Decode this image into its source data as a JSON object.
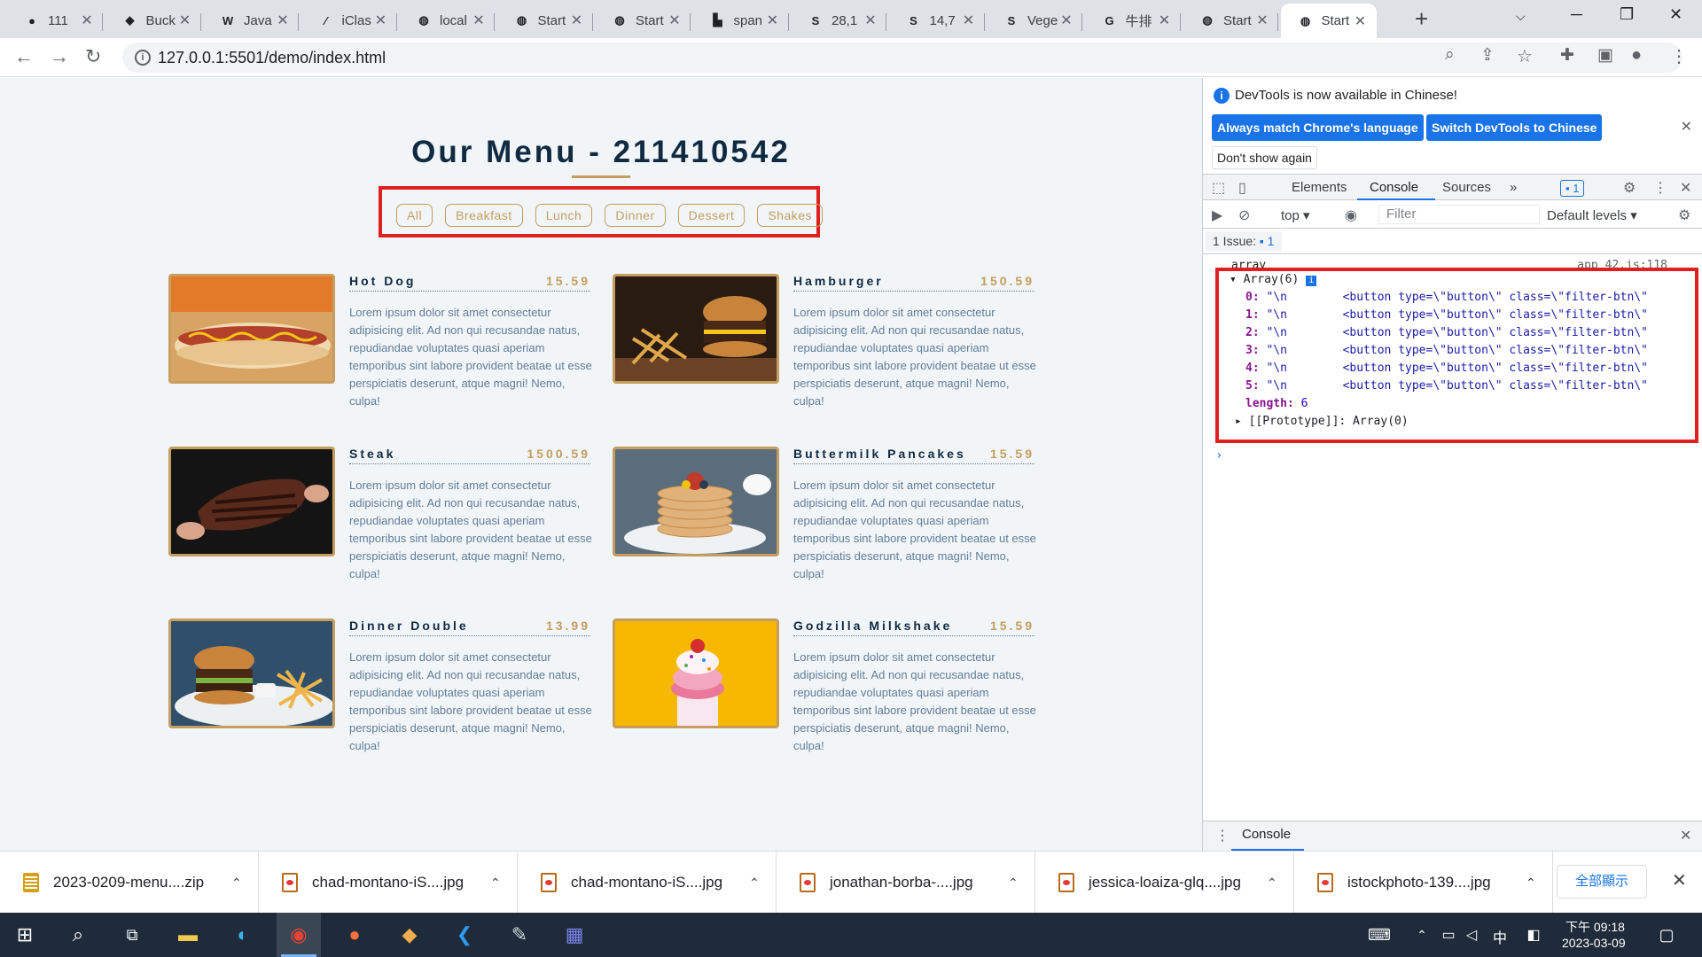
{
  "tabs": [
    {
      "title": "111",
      "icon": "github-icon",
      "icon_glyph": "●"
    },
    {
      "title": "Buck",
      "icon": "bucket-icon",
      "icon_glyph": "◆"
    },
    {
      "title": "Java",
      "icon": "w3schools-icon",
      "icon_glyph": "W"
    },
    {
      "title": "iClas",
      "icon": "iclass-icon",
      "icon_glyph": "∕"
    },
    {
      "title": "local",
      "icon": "globe-icon",
      "icon_glyph": "◍"
    },
    {
      "title": "Start",
      "icon": "globe-icon",
      "icon_glyph": "◍"
    },
    {
      "title": "Start",
      "icon": "globe-icon",
      "icon_glyph": "◍"
    },
    {
      "title": "span",
      "icon": "stackoverflow-icon",
      "icon_glyph": "▙"
    },
    {
      "title": "28,1",
      "icon": "s-icon",
      "icon_glyph": "S"
    },
    {
      "title": "14,7",
      "icon": "s-icon",
      "icon_glyph": "S"
    },
    {
      "title": "Vege",
      "icon": "s-icon",
      "icon_glyph": "S"
    },
    {
      "title": "牛排",
      "icon": "google-icon",
      "icon_glyph": "G"
    },
    {
      "title": "Start",
      "icon": "globe-icon",
      "icon_glyph": "◍"
    },
    {
      "title": "Start",
      "icon": "globe-icon",
      "icon_glyph": "◍",
      "active": true
    }
  ],
  "address": {
    "url": "127.0.0.1:5501/demo/index.html"
  },
  "page": {
    "title": "Our Menu - 211410542",
    "filters": [
      "All",
      "Breakfast",
      "Lunch",
      "Dinner",
      "Dessert",
      "Shakes"
    ],
    "items": [
      {
        "name": "Hot Dog",
        "price": "15.59",
        "desc": "Lorem ipsum dolor sit amet consectetur adipisicing elit. Ad non qui recusandae natus, repudiandae voluptates quasi aperiam temporibus sint labore provident beatae ut esse perspiciatis deserunt, atque magni! Nemo, culpa!",
        "photo": "hot-dog-photo"
      },
      {
        "name": "Hamburger",
        "price": "150.59",
        "desc": "Lorem ipsum dolor sit amet consectetur adipisicing elit. Ad non qui recusandae natus, repudiandae voluptates quasi aperiam temporibus sint labore provident beatae ut esse perspiciatis deserunt, atque magni! Nemo, culpa!",
        "photo": "hamburger-photo"
      },
      {
        "name": "Steak",
        "price": "1500.59",
        "desc": "Lorem ipsum dolor sit amet consectetur adipisicing elit. Ad non qui recusandae natus, repudiandae voluptates quasi aperiam temporibus sint labore provident beatae ut esse perspiciatis deserunt, atque magni! Nemo, culpa!",
        "photo": "steak-photo"
      },
      {
        "name": "Buttermilk Pancakes",
        "price": "15.59",
        "desc": "Lorem ipsum dolor sit amet consectetur adipisicing elit. Ad non qui recusandae natus, repudiandae voluptates quasi aperiam temporibus sint labore provident beatae ut esse perspiciatis deserunt, atque magni! Nemo, culpa!",
        "photo": "pancakes-photo"
      },
      {
        "name": "Dinner Double",
        "price": "13.99",
        "desc": "Lorem ipsum dolor sit amet consectetur adipisicing elit. Ad non qui recusandae natus, repudiandae voluptates quasi aperiam temporibus sint labore provident beatae ut esse perspiciatis deserunt, atque magni! Nemo, culpa!",
        "photo": "dinner-double-photo"
      },
      {
        "name": "Godzilla Milkshake",
        "price": "15.59",
        "desc": "Lorem ipsum dolor sit amet consectetur adipisicing elit. Ad non qui recusandae natus, repudiandae voluptates quasi aperiam temporibus sint labore provident beatae ut esse perspiciatis deserunt, atque magni! Nemo, culpa!",
        "photo": "milkshake-photo"
      }
    ]
  },
  "devtools": {
    "banner_text": "DevTools is now available in Chinese!",
    "btn_match": "Always match Chrome's language",
    "btn_switch": "Switch DevTools to Chinese",
    "btn_dont_show": "Don't show again",
    "tabs": [
      "Elements",
      "Console",
      "Sources"
    ],
    "active_tab": "Console",
    "issues_badge": "1",
    "context": "top",
    "filter_placeholder": "Filter",
    "levels": "Default levels",
    "issues_label": "1 Issue:",
    "issues_count": "1",
    "log_label": "array",
    "log_source": "app_42.js:118",
    "array_head": "Array(6)",
    "array_entries": [
      {
        "key": "0:",
        "value": "\"\\n        <button type=\\\"button\\\" class=\\\"filter-btn\\\""
      },
      {
        "key": "1:",
        "value": "\"\\n        <button type=\\\"button\\\" class=\\\"filter-btn\\\""
      },
      {
        "key": "2:",
        "value": "\"\\n        <button type=\\\"button\\\" class=\\\"filter-btn\\\""
      },
      {
        "key": "3:",
        "value": "\"\\n        <button type=\\\"button\\\" class=\\\"filter-btn\\\""
      },
      {
        "key": "4:",
        "value": "\"\\n        <button type=\\\"button\\\" class=\\\"filter-btn\\\""
      },
      {
        "key": "5:",
        "value": "\"\\n        <button type=\\\"button\\\" class=\\\"filter-btn\\\""
      }
    ],
    "length_key": "length:",
    "length_value": "6",
    "prototype": "[[Prototype]]: Array(0)",
    "drawer_label": "Console"
  },
  "downloads": {
    "items": [
      {
        "name": "2023-0209-menu....zip",
        "type": "zip"
      },
      {
        "name": "chad-montano-iS....jpg",
        "type": "image"
      },
      {
        "name": "chad-montano-iS....jpg",
        "type": "image"
      },
      {
        "name": "jonathan-borba-....jpg",
        "type": "image"
      },
      {
        "name": "jessica-loaiza-glq....jpg",
        "type": "image"
      },
      {
        "name": "istockphoto-139....jpg",
        "type": "image"
      }
    ],
    "show_all": "全部顯示"
  },
  "taskbar": {
    "time": "下午 09:18",
    "date": "2023-03-09",
    "ime": "中"
  },
  "colors": {
    "accent_gold": "#c59d5f",
    "title_navy": "#102a42",
    "highlight_red": "#e02020",
    "devtools_blue": "#1a73e8"
  }
}
